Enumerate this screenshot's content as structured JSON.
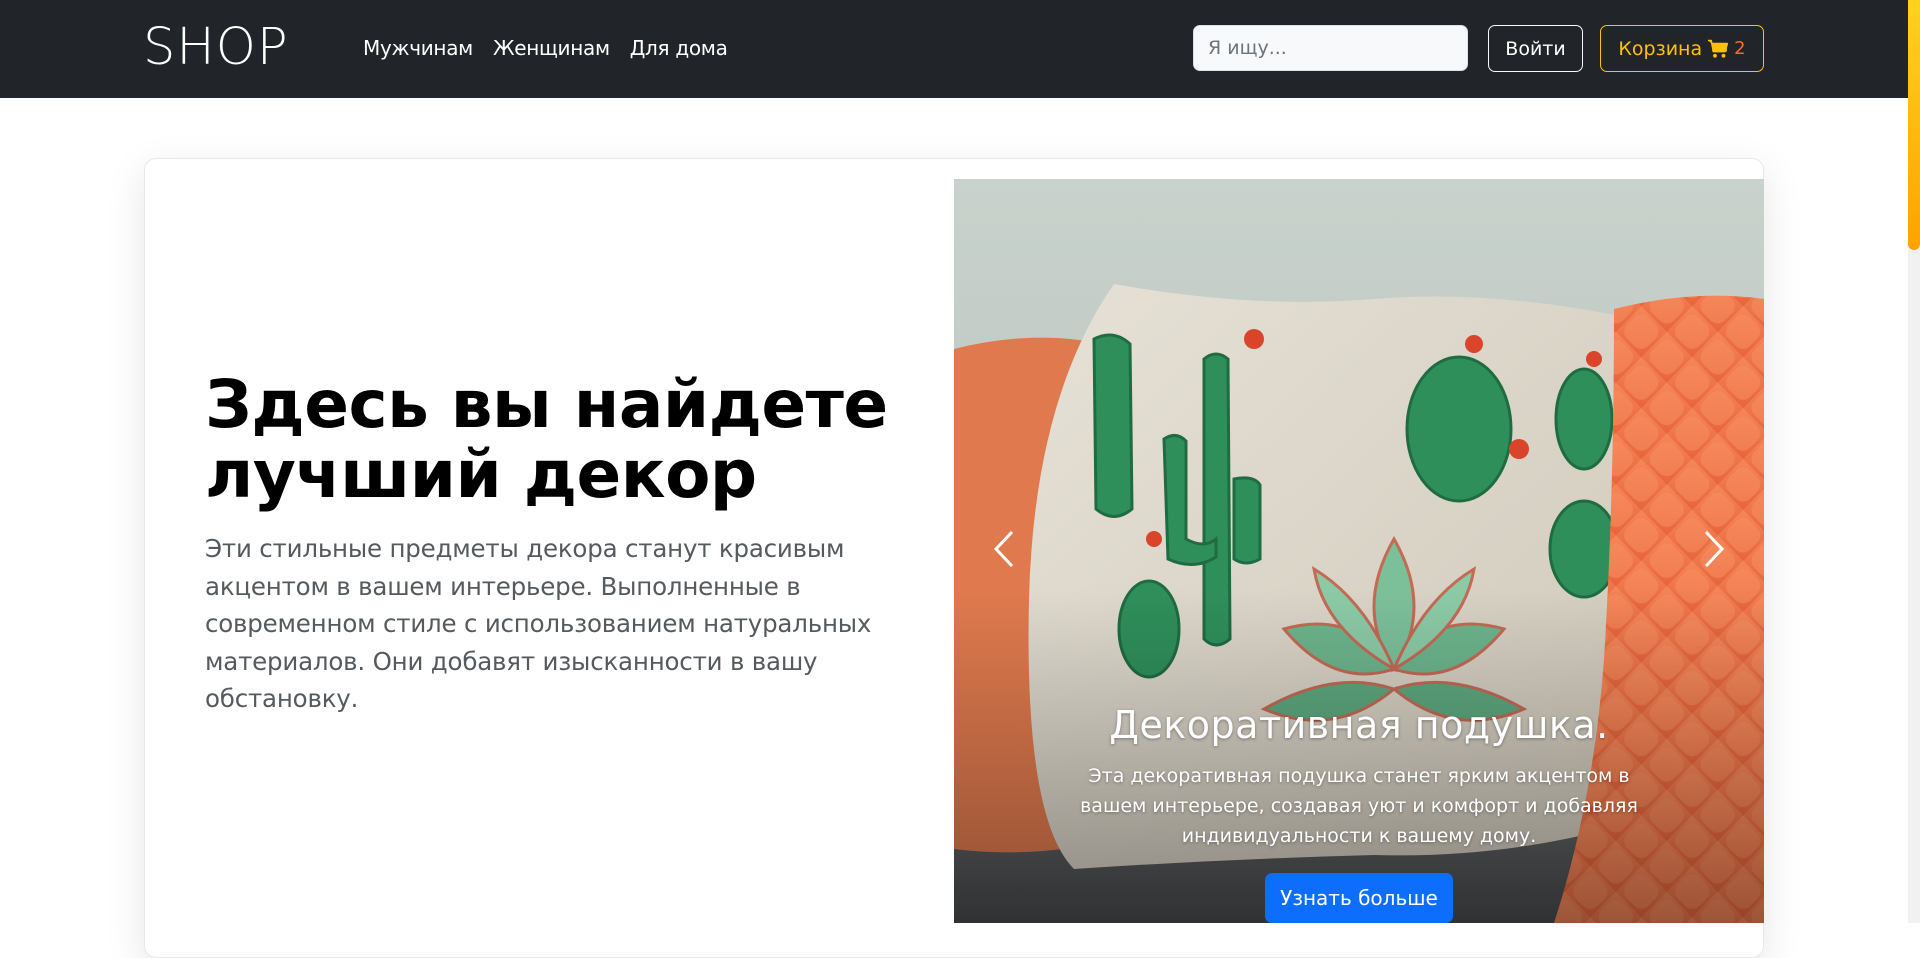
{
  "navbar": {
    "brand": "SHOP",
    "links": [
      {
        "label": "Мужчинам"
      },
      {
        "label": "Женщинам"
      },
      {
        "label": "Для дома"
      }
    ],
    "search_placeholder": "Я ищу...",
    "login_label": "Войти",
    "cart_label": "Корзина",
    "cart_icon": "cart-icon",
    "cart_count": "2"
  },
  "hero": {
    "title": "Здесь вы найдете лучший декор",
    "text": "Эти стильные предметы декора станут красивым акцентом в вашем интерьере. Выполненные в современном стиле с использованием натуральных материалов. Они добавят изысканности в вашу обстановку."
  },
  "carousel": {
    "prev_icon": "chevron-left-icon",
    "next_icon": "chevron-right-icon",
    "slide": {
      "caption_title": "Декоративная подушка.",
      "caption_text": "Эта декоративная подушка станет ярким акцентом в вашем интерьере, создавая уют и комфорт и добавляя индивидуальности к вашему дому.",
      "button_label": "Узнать больше"
    }
  },
  "colors": {
    "navbar_bg": "#212529",
    "accent_warning": "#ffc107",
    "primary": "#0d6efd",
    "cart_count": "#ff6a1a"
  }
}
